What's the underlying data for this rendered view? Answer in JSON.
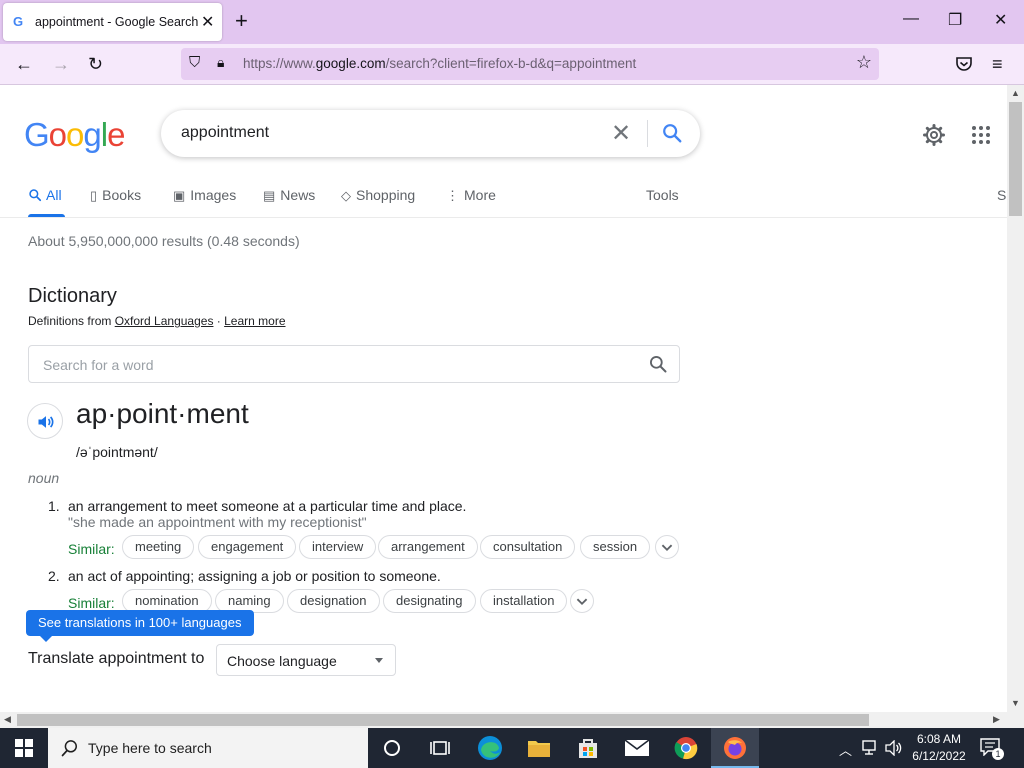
{
  "browser": {
    "tab_title": "appointment - Google Search",
    "tab_favicon": "G",
    "url_prefix": "https://www.",
    "url_domain": "google.com",
    "url_rest": "/search?client=firefox-b-d&q=appointment",
    "theme_tabbar": "#e2c6f0",
    "theme_navbar": "#f6e9fb"
  },
  "google": {
    "logo_letters": [
      {
        "ch": "G",
        "color": "#4285f4"
      },
      {
        "ch": "o",
        "color": "#ea4335"
      },
      {
        "ch": "o",
        "color": "#fbbc05"
      },
      {
        "ch": "g",
        "color": "#4285f4"
      },
      {
        "ch": "l",
        "color": "#34a853"
      },
      {
        "ch": "e",
        "color": "#ea4335"
      }
    ],
    "query": "appointment",
    "tabs": [
      {
        "label": "All",
        "icon": "search-icon",
        "glyph": "🔍"
      },
      {
        "label": "Books",
        "icon": "book-icon",
        "glyph": "▯"
      },
      {
        "label": "Images",
        "icon": "image-icon",
        "glyph": "▣"
      },
      {
        "label": "News",
        "icon": "news-icon",
        "glyph": "▤"
      },
      {
        "label": "Shopping",
        "icon": "tag-icon",
        "glyph": "◇"
      },
      {
        "label": "More",
        "icon": "more-vert-icon",
        "glyph": "⋮"
      }
    ],
    "tools_label": "Tools",
    "edge_label": "S",
    "stats": "About 5,950,000,000 results (0.48 seconds)",
    "accent": "#1a73e8"
  },
  "dictionary": {
    "title": "Dictionary",
    "source_prefix": "Definitions from ",
    "source_link": "Oxford Languages",
    "separator": " · ",
    "learn_more": "Learn more",
    "search_placeholder": "Search for a word",
    "headword": "ap·point·ment",
    "phonetic": "/əˈpointmənt/",
    "part_of_speech": "noun",
    "senses": [
      {
        "num": "1.",
        "definition": "an arrangement to meet someone at a particular time and place.",
        "example": "\"she made an appointment with my receptionist\"",
        "similar_label": "Similar:",
        "similar": [
          "meeting",
          "engagement",
          "interview",
          "arrangement",
          "consultation",
          "session"
        ]
      },
      {
        "num": "2.",
        "definition": "an act of appointing; assigning a job or position to someone.",
        "similar_label": "Similar:",
        "similar": [
          "nomination",
          "naming",
          "designation",
          "designating",
          "installation"
        ]
      }
    ],
    "translations_tip": "See translations in 100+ languages",
    "translate_label": "Translate appointment to",
    "language_select": "Choose language"
  },
  "taskbar": {
    "search_placeholder": "Type here to search",
    "time": "6:08 AM",
    "date": "6/12/2022",
    "notification_count": "1"
  }
}
